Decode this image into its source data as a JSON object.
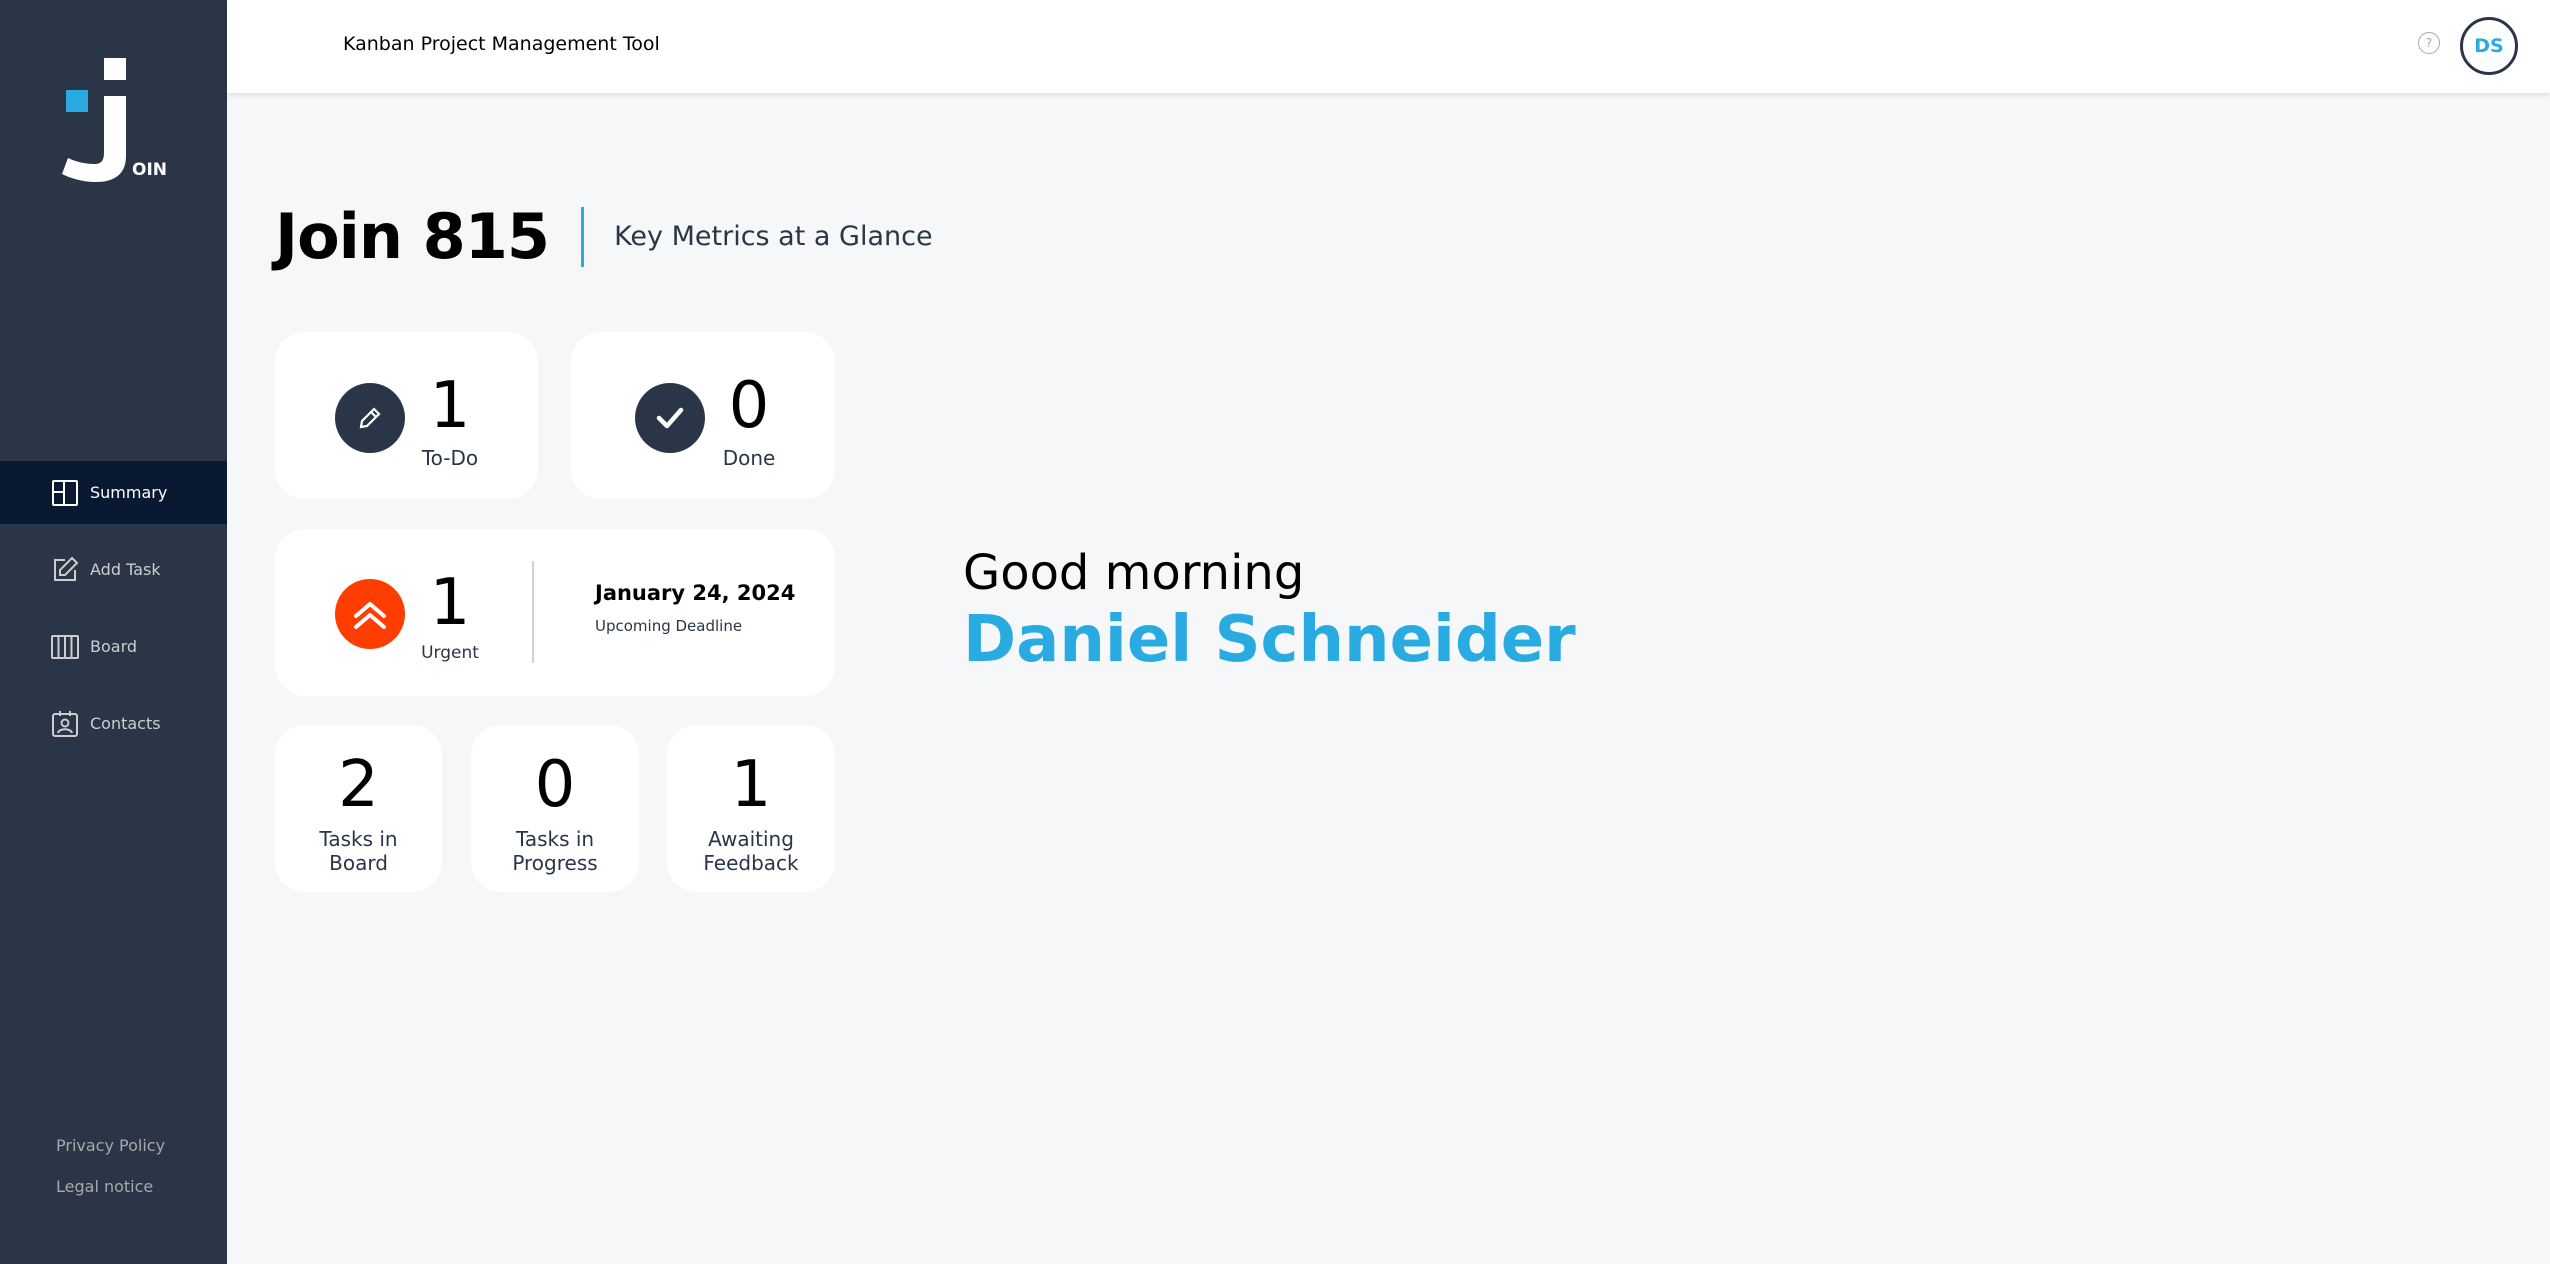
{
  "sidebar": {
    "logo_text": "OIN",
    "items": [
      {
        "label": "Summary",
        "active": true
      },
      {
        "label": "Add Task"
      },
      {
        "label": "Board"
      },
      {
        "label": "Contacts"
      }
    ],
    "legal": {
      "privacy": "Privacy Policy",
      "notice": "Legal notice"
    }
  },
  "header": {
    "title": "Kanban Project Management Tool",
    "help": "?",
    "avatar_initials": "DS"
  },
  "page": {
    "title": "Join 815",
    "subtitle": "Key Metrics at a Glance"
  },
  "metrics": {
    "todo": {
      "count": "1",
      "label": "To-Do"
    },
    "done": {
      "count": "0",
      "label": "Done"
    },
    "urgent": {
      "count": "1",
      "label": "Urgent"
    },
    "deadline": {
      "date": "January 24, 2024",
      "label": "Upcoming Deadline"
    },
    "board": {
      "count": "2",
      "label_line1": "Tasks in",
      "label_line2": "Board"
    },
    "progress": {
      "count": "0",
      "label_line1": "Tasks in",
      "label_line2": "Progress"
    },
    "feedback": {
      "count": "1",
      "label_line1": "Awaiting",
      "label_line2": "Feedback"
    }
  },
  "greeting": {
    "text": "Good morning",
    "name": "Daniel Schneider"
  },
  "colors": {
    "sidebar": "#2a3647",
    "active_nav": "#091931",
    "accent": "#29abe2",
    "urgent": "#ff3d00"
  }
}
